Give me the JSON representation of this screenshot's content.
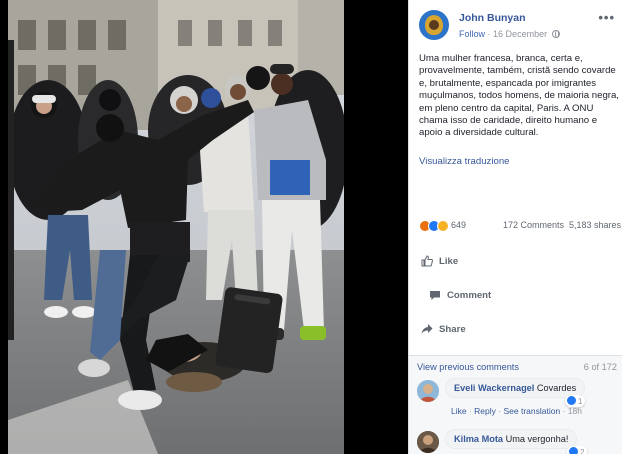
{
  "post": {
    "author": "John Bunyan",
    "follow": "Follow",
    "separator": "·",
    "date": "16 December",
    "more": "•••",
    "text": "Uma mulher francesa, branca, certa e, provavelmente, também, cristã sendo covarde e, brutalmente, espancada por imigrantes muçulmanos, todos homens, de maioria negra, em pleno centro da capital, Paris. A ONU chama isso de caridade, direito humano e apoio a diversidade cultural.",
    "see_translation": "Visualizza traduzione"
  },
  "stats": {
    "reactions_count": "649",
    "comments": "172 Comments",
    "shares": "5,183 shares",
    "reaction_icons": [
      "angry-icon",
      "like-icon",
      "sad-icon"
    ]
  },
  "actions": {
    "like": "Like",
    "comment": "Comment",
    "share": "Share"
  },
  "comments": {
    "view_previous": "View previous comments",
    "count": "6 of 172",
    "items": [
      {
        "name": "Eveli Wackernagel",
        "text": "Covardes",
        "likes": "1",
        "like_link": "Like",
        "reply_link": "Reply",
        "translation_link": "See translation",
        "time": "18h"
      },
      {
        "name": "Kilma Mota",
        "text": "Uma vergonha!",
        "likes": "2"
      }
    ]
  },
  "colors": {
    "link_blue": "#365899",
    "accent_blue": "#4267b2",
    "meta_gray": "#90949c",
    "viewer_black": "#000000"
  }
}
